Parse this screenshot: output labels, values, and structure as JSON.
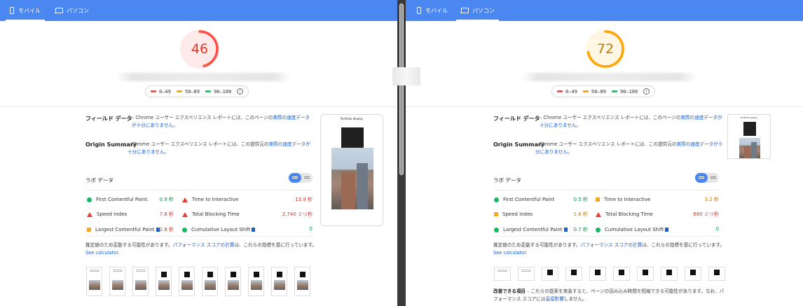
{
  "tabs": {
    "mobile_label": "モバイル",
    "desktop_label": "パソコン"
  },
  "legend": {
    "red": "0–49",
    "orange": "50–89",
    "green": "90–100"
  },
  "colors": {
    "red": "#ff4e42",
    "orange": "#ffa400",
    "green": "#0cce6b",
    "link": "#1a5fd1",
    "tabbar": "#4b87f0"
  },
  "sections": {
    "field_title": "フィールド データ",
    "field_desc": "– Chrome ユーザー エクスペリエンス レポートには、このページの",
    "field_link": "実際の速度データが十分にありません。",
    "origin_title": "Origin Summary",
    "origin_desc": "– Chrome ユーザー エクスペリエンス レポートには、この提供元の",
    "origin_link": "実際の速度データが十分にありません。",
    "lab_title": "ラボ データ",
    "estimate_1": "推定値のため変動する可能性があります。",
    "estimate_link": "パフォーマンス スコアの計算",
    "estimate_2": "は、これらの指標を基に行っています。",
    "see_calc": "See calculator.",
    "improve_title": "改善できる項目",
    "improve_desc": "– これらの提案を実装すると、ページの読み込み時間を短縮できる可能性があります。なお、パフォーマンス スコアには",
    "improve_link": "直接影響",
    "improve_tail": "しません。"
  },
  "left": {
    "score": "46",
    "score_fraction": 0.46,
    "metrics": {
      "fcp_label": "First Contentful Paint",
      "fcp_value": "0.9 秒",
      "si_label": "Speed Index",
      "si_value": "7.6 秒",
      "lcp_label": "Largest Contentful Paint",
      "lcp_value": "2.8 秒",
      "tti_label": "Time to Interactive",
      "tti_value": "13.9 秒",
      "tbt_label": "Total Blocking Time",
      "tbt_value": "2,740 ミリ秒",
      "cls_label": "Cumulative Layout Shift",
      "cls_value": "0"
    },
    "phone_title": "Portfolio display"
  },
  "right": {
    "score": "72",
    "score_fraction": 0.72,
    "metrics": {
      "fcp_label": "First Contentful Paint",
      "fcp_value": "0.5 秒",
      "si_label": "Speed Index",
      "si_value": "1.6 秒",
      "lcp_label": "Largest Contentful Paint",
      "lcp_value": "0.7 秒",
      "tti_label": "Time to Interactive",
      "tti_value": "3.2 秒",
      "tbt_label": "Total Blocking Time",
      "tbt_value": "680 ミリ秒",
      "cls_label": "Cumulative Layout Shift",
      "cls_value": "0"
    },
    "phone_title": "Portfolio display"
  }
}
